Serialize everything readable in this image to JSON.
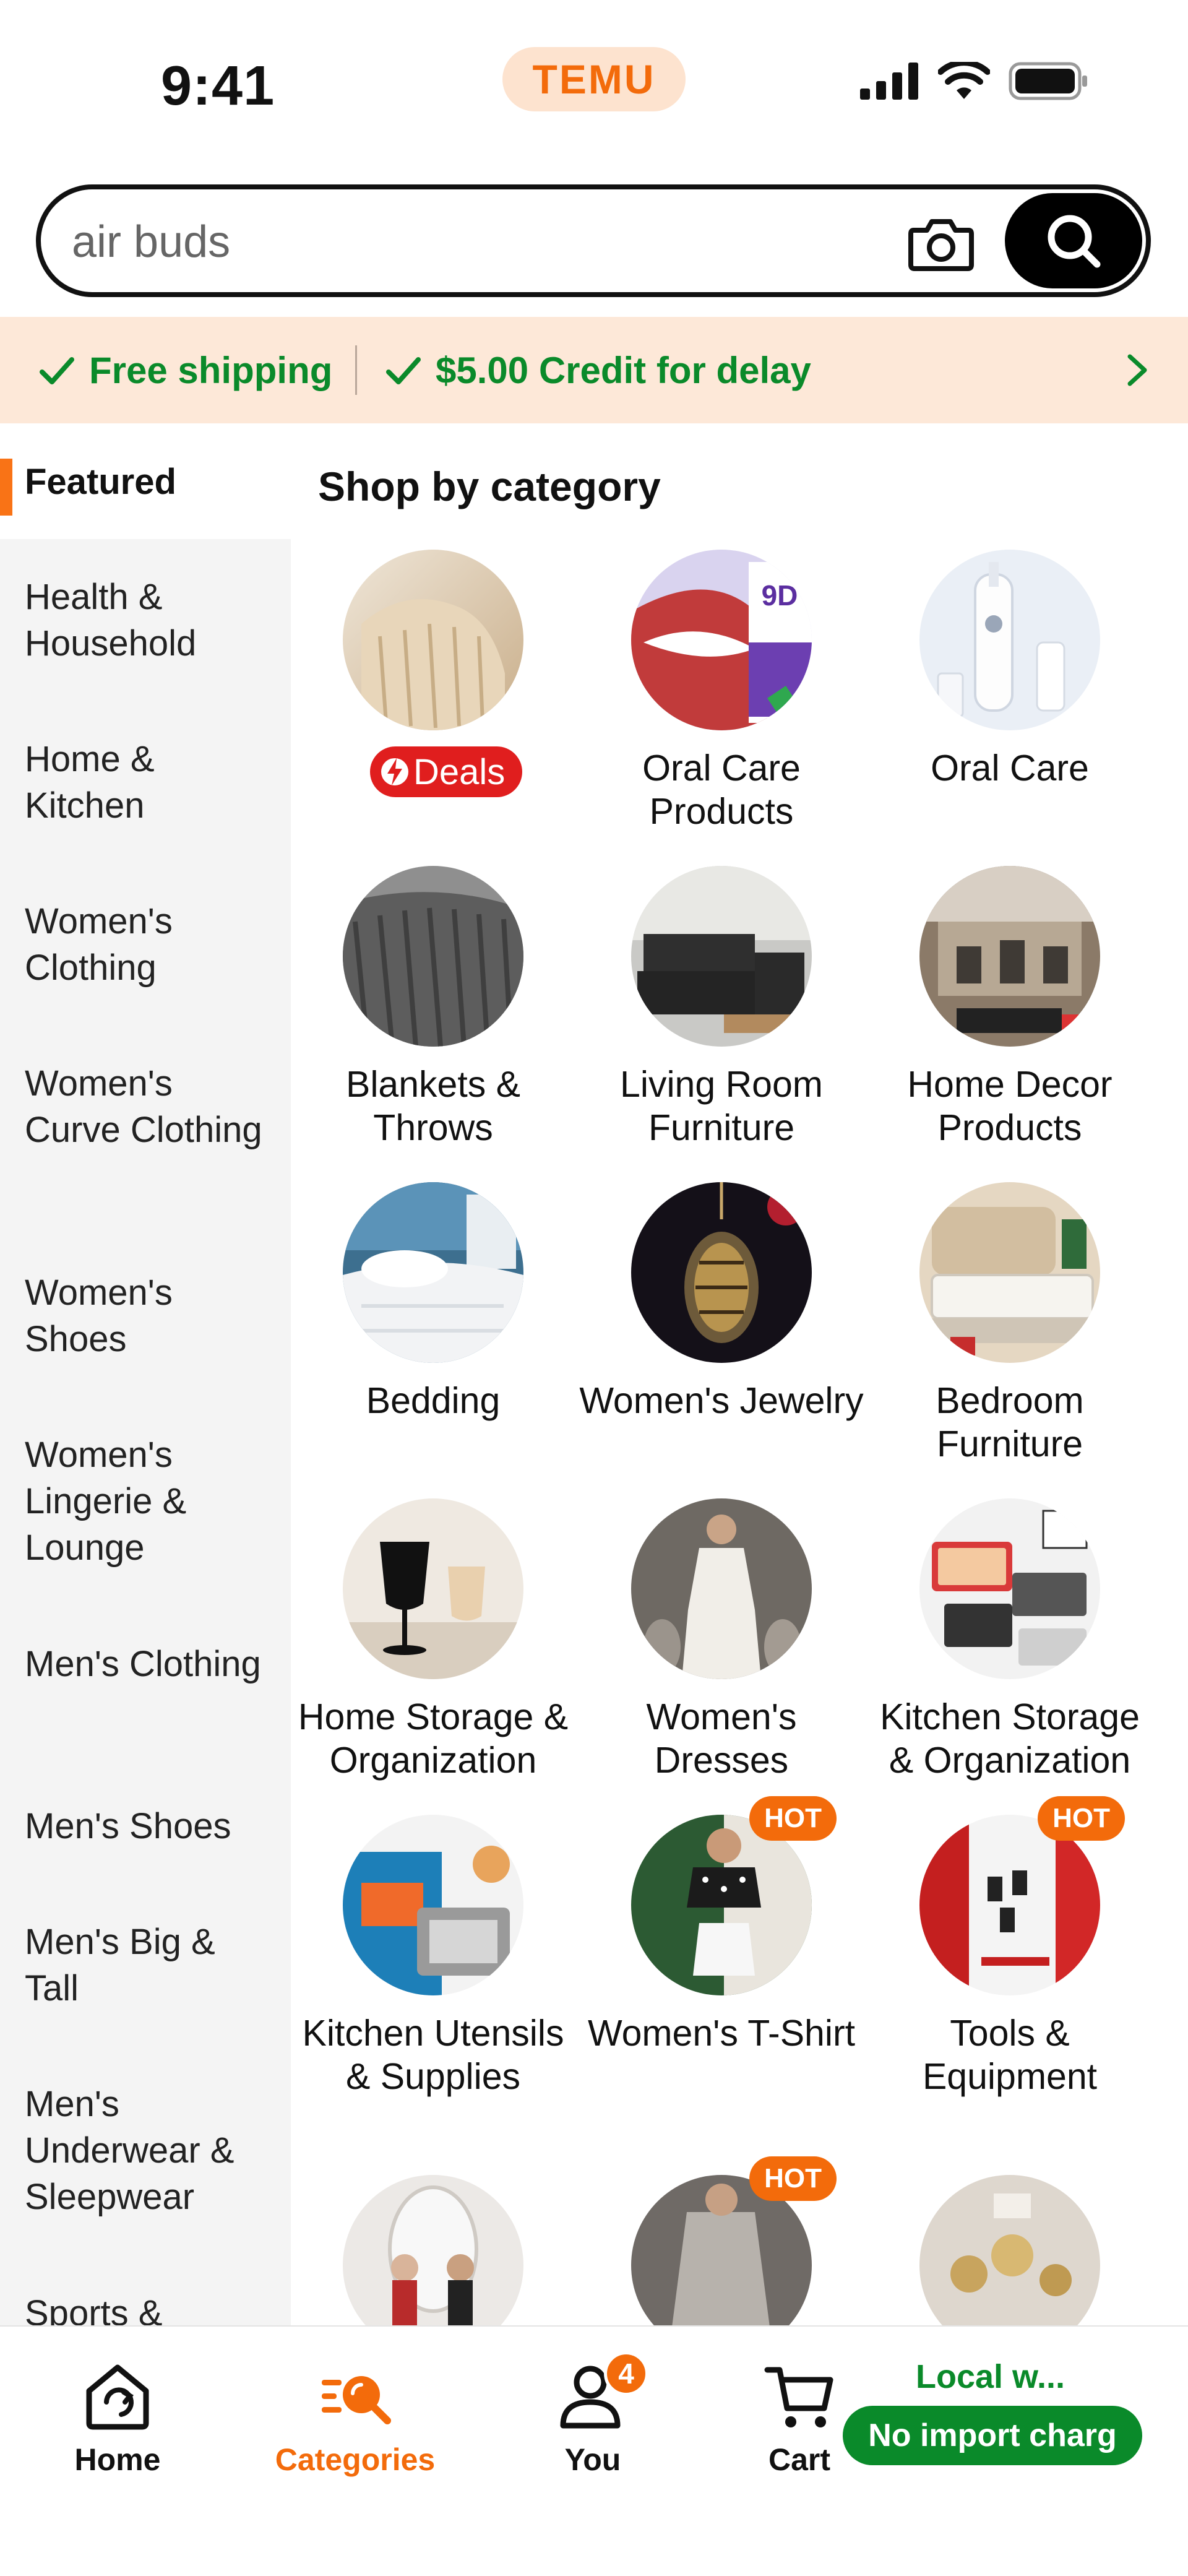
{
  "status_bar": {
    "time": "9:41",
    "brand": "TEMU"
  },
  "search": {
    "value": "air buds",
    "placeholder": "air buds"
  },
  "promo": {
    "free_shipping": "Free shipping",
    "credit": "$5.00 Credit for delay"
  },
  "sidebar": {
    "featured": "Featured",
    "items": [
      {
        "label": "Health & Household"
      },
      {
        "label": "Home & Kitchen"
      },
      {
        "label": "Women's Clothing"
      },
      {
        "label": "Women's Curve Clothing"
      },
      {
        "label": "Women's Shoes"
      },
      {
        "label": "Women's Lingerie & Lounge"
      },
      {
        "label": "Men's Clothing"
      },
      {
        "label": "Men's Shoes"
      },
      {
        "label": "Men's Big & Tall"
      },
      {
        "label": "Men's Underwear & Sleepwear"
      },
      {
        "label": "Sports &"
      }
    ]
  },
  "main": {
    "title": "Shop by category",
    "categories": [
      {
        "label": "",
        "deals": "Deals",
        "hot": "",
        "icon": "blanket-image"
      },
      {
        "label": "Oral Care Products",
        "hot": "",
        "icon": "teeth-whitening-image"
      },
      {
        "label": "Oral Care",
        "hot": "",
        "icon": "water-flosser-image"
      },
      {
        "label": "Blankets & Throws",
        "hot": "",
        "icon": "grey-blanket-image"
      },
      {
        "label": "Living Room Furniture",
        "hot": "",
        "icon": "sofa-image"
      },
      {
        "label": "Home Decor Products",
        "hot": "",
        "icon": "gym-room-image"
      },
      {
        "label": "Bedding",
        "hot": "",
        "icon": "white-bedding-image"
      },
      {
        "label": "Women's Jewelry",
        "hot": "",
        "icon": "pendant-image"
      },
      {
        "label": "Bedroom Furniture",
        "hot": "",
        "icon": "mattress-image"
      },
      {
        "label": "Home Storage & Organization",
        "hot": "",
        "icon": "wine-glass-image"
      },
      {
        "label": "Women's Dresses",
        "hot": "",
        "icon": "white-dress-image"
      },
      {
        "label": "Kitchen Storage & Organization",
        "hot": "",
        "icon": "containers-image"
      },
      {
        "label": "Kitchen Utensils & Supplies",
        "hot": "",
        "icon": "blender-image"
      },
      {
        "label": "Women's T-Shirt",
        "hot": "HOT",
        "icon": "tshirt-model-image"
      },
      {
        "label": "Tools & Equipment",
        "hot": "HOT",
        "icon": "tools-image"
      },
      {
        "label": "",
        "hot": "",
        "icon": "mirror-image"
      },
      {
        "label": "",
        "hot": "HOT",
        "icon": "sequin-dress-image"
      },
      {
        "label": "",
        "hot": "",
        "icon": "ornaments-image"
      }
    ]
  },
  "bottom_nav": {
    "home": "Home",
    "categories": "Categories",
    "you": "You",
    "you_badge": "4",
    "cart": "Cart",
    "local_title": "Local w...",
    "local_pill": "No import charg"
  },
  "colors": {
    "accent": "#f36b0b",
    "green": "#0a8a2a",
    "red": "#e01e1e"
  }
}
